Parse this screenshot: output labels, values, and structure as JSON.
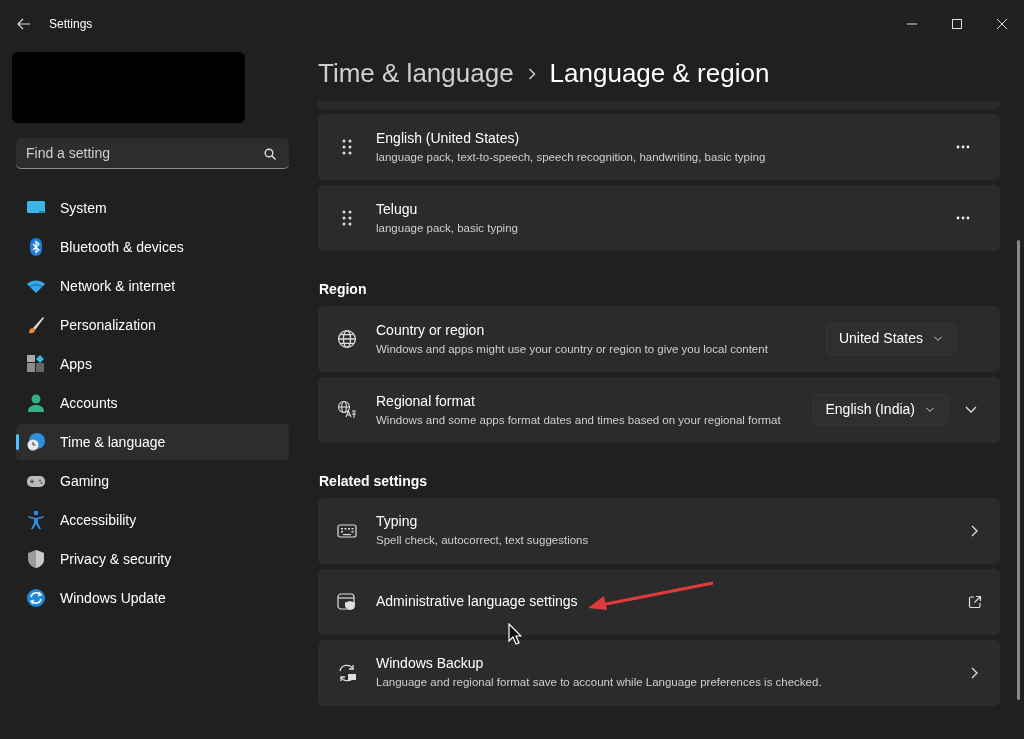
{
  "window": {
    "title": "Settings"
  },
  "sidebar": {
    "search": {
      "placeholder": "Find a setting"
    },
    "items": [
      {
        "label": "System",
        "selected": false
      },
      {
        "label": "Bluetooth & devices",
        "selected": false
      },
      {
        "label": "Network & internet",
        "selected": false
      },
      {
        "label": "Personalization",
        "selected": false
      },
      {
        "label": "Apps",
        "selected": false
      },
      {
        "label": "Accounts",
        "selected": false
      },
      {
        "label": "Time & language",
        "selected": true
      },
      {
        "label": "Gaming",
        "selected": false
      },
      {
        "label": "Accessibility",
        "selected": false
      },
      {
        "label": "Privacy & security",
        "selected": false
      },
      {
        "label": "Windows Update",
        "selected": false
      }
    ]
  },
  "breadcrumb": {
    "parent": "Time & language",
    "current": "Language & region"
  },
  "sections": [
    {
      "cards": [
        {
          "kind": "language",
          "title": "English (United States)",
          "subtitle": "language pack, text-to-speech, speech recognition, handwriting, basic typing"
        },
        {
          "kind": "language",
          "title": "Telugu",
          "subtitle": "language pack, basic typing"
        }
      ]
    },
    {
      "heading": "Region",
      "cards": [
        {
          "kind": "select",
          "title": "Country or region",
          "subtitle": "Windows and apps might use your country or region to give you local content",
          "value": "United States"
        },
        {
          "kind": "select_expand",
          "title": "Regional format",
          "subtitle": "Windows and some apps format dates and times based on your regional format",
          "value": "English (India)",
          "expanded": false
        }
      ]
    },
    {
      "heading": "Related settings",
      "cards": [
        {
          "kind": "link",
          "title": "Typing",
          "subtitle": "Spell check, autocorrect, text suggestions"
        },
        {
          "kind": "external",
          "title": "Administrative language settings"
        },
        {
          "kind": "link",
          "title": "Windows Backup",
          "subtitle": "Language and regional format save to account while Language preferences is checked."
        }
      ]
    }
  ]
}
